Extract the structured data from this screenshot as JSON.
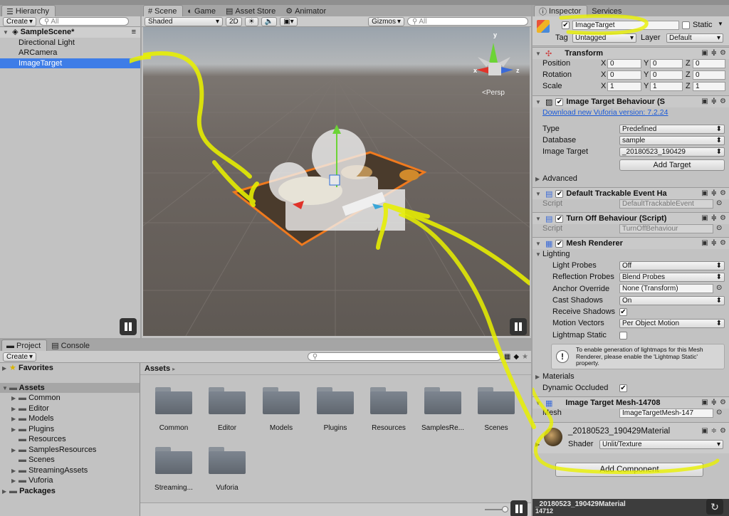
{
  "hierarchy": {
    "tab": "Hierarchy",
    "create": "Create",
    "search_placeholder": "All",
    "scene": "SampleScene*",
    "items": [
      {
        "label": "Directional Light"
      },
      {
        "label": "ARCamera"
      },
      {
        "label": "ImageTarget"
      }
    ]
  },
  "scene_tabs": {
    "scene": "Scene",
    "game": "Game",
    "asset_store": "Asset Store",
    "animator": "Animator"
  },
  "scene_toolbar": {
    "shading": "Shaded",
    "mode_2d": "2D",
    "gizmos": "Gizmos",
    "search_placeholder": "All",
    "persp": "Persp",
    "axis_x": "x",
    "axis_y": "y",
    "axis_z": "z"
  },
  "project": {
    "tab_project": "Project",
    "tab_console": "Console",
    "create": "Create",
    "favorites": "Favorites",
    "assets": "Assets",
    "tree": [
      "Common",
      "Editor",
      "Models",
      "Plugins",
      "Resources",
      "SamplesResources",
      "Scenes",
      "StreamingAssets",
      "Vuforia"
    ],
    "packages": "Packages",
    "breadcrumb": "Assets",
    "folders": [
      "Common",
      "Editor",
      "Models",
      "Plugins",
      "Resources",
      "SamplesRe...",
      "Scenes",
      "Streaming...",
      "Vuforia"
    ]
  },
  "inspector": {
    "tab_inspector": "Inspector",
    "tab_services": "Services",
    "object_name": "ImageTarget",
    "static_label": "Static",
    "tag_label": "Tag",
    "tag_value": "Untagged",
    "layer_label": "Layer",
    "layer_value": "Default",
    "transform": {
      "title": "Transform",
      "position_label": "Position",
      "rotation_label": "Rotation",
      "scale_label": "Scale",
      "x": "X",
      "y": "Y",
      "z": "Z",
      "position": [
        "0",
        "0",
        "0"
      ],
      "rotation": [
        "0",
        "0",
        "0"
      ],
      "scale": [
        "1",
        "1",
        "1"
      ]
    },
    "itb": {
      "title": "Image Target Behaviour (S",
      "download_link": "Download new Vuforia version: 7.2.24",
      "type_label": "Type",
      "type_value": "Predefined",
      "database_label": "Database",
      "database_value": "sample",
      "image_target_label": "Image Target",
      "image_target_value": "_20180523_190429",
      "add_target": "Add Target",
      "advanced": "Advanced"
    },
    "dte": {
      "title": "Default Trackable Event Ha",
      "script_label": "Script",
      "script_value": "DefaultTrackableEvent"
    },
    "tob": {
      "title": "Turn Off Behaviour (Script)",
      "script_label": "Script",
      "script_value": "TurnOffBehaviour"
    },
    "mesh_renderer": {
      "title": "Mesh Renderer",
      "lighting": "Lighting",
      "light_probes_label": "Light Probes",
      "light_probes_value": "Off",
      "reflection_probes_label": "Reflection Probes",
      "reflection_probes_value": "Blend Probes",
      "anchor_override_label": "Anchor Override",
      "anchor_override_value": "None (Transform)",
      "cast_shadows_label": "Cast Shadows",
      "cast_shadows_value": "On",
      "receive_shadows_label": "Receive Shadows",
      "motion_vectors_label": "Motion Vectors",
      "motion_vectors_value": "Per Object Motion",
      "lightmap_static_label": "Lightmap Static",
      "info": "To enable generation of lightmaps for this Mesh Renderer, please enable the 'Lightmap Static' property.",
      "materials": "Materials",
      "dynamic_occluded_label": "Dynamic Occluded"
    },
    "mesh_filter": {
      "title": "Image Target Mesh-14708",
      "mesh_label": "Mesh",
      "mesh_value": "ImageTargetMesh-147"
    },
    "material": {
      "name": "_20180523_190429Material",
      "shader_label": "Shader",
      "shader_value": "Unlit/Texture"
    },
    "add_component": "Add Component",
    "preview_label": "_20180523_190429Material",
    "preview_sub": "14712"
  },
  "colors": {
    "selection": "#3e7de7",
    "highlighter": "#e8f000",
    "link": "#1a5ad8"
  }
}
